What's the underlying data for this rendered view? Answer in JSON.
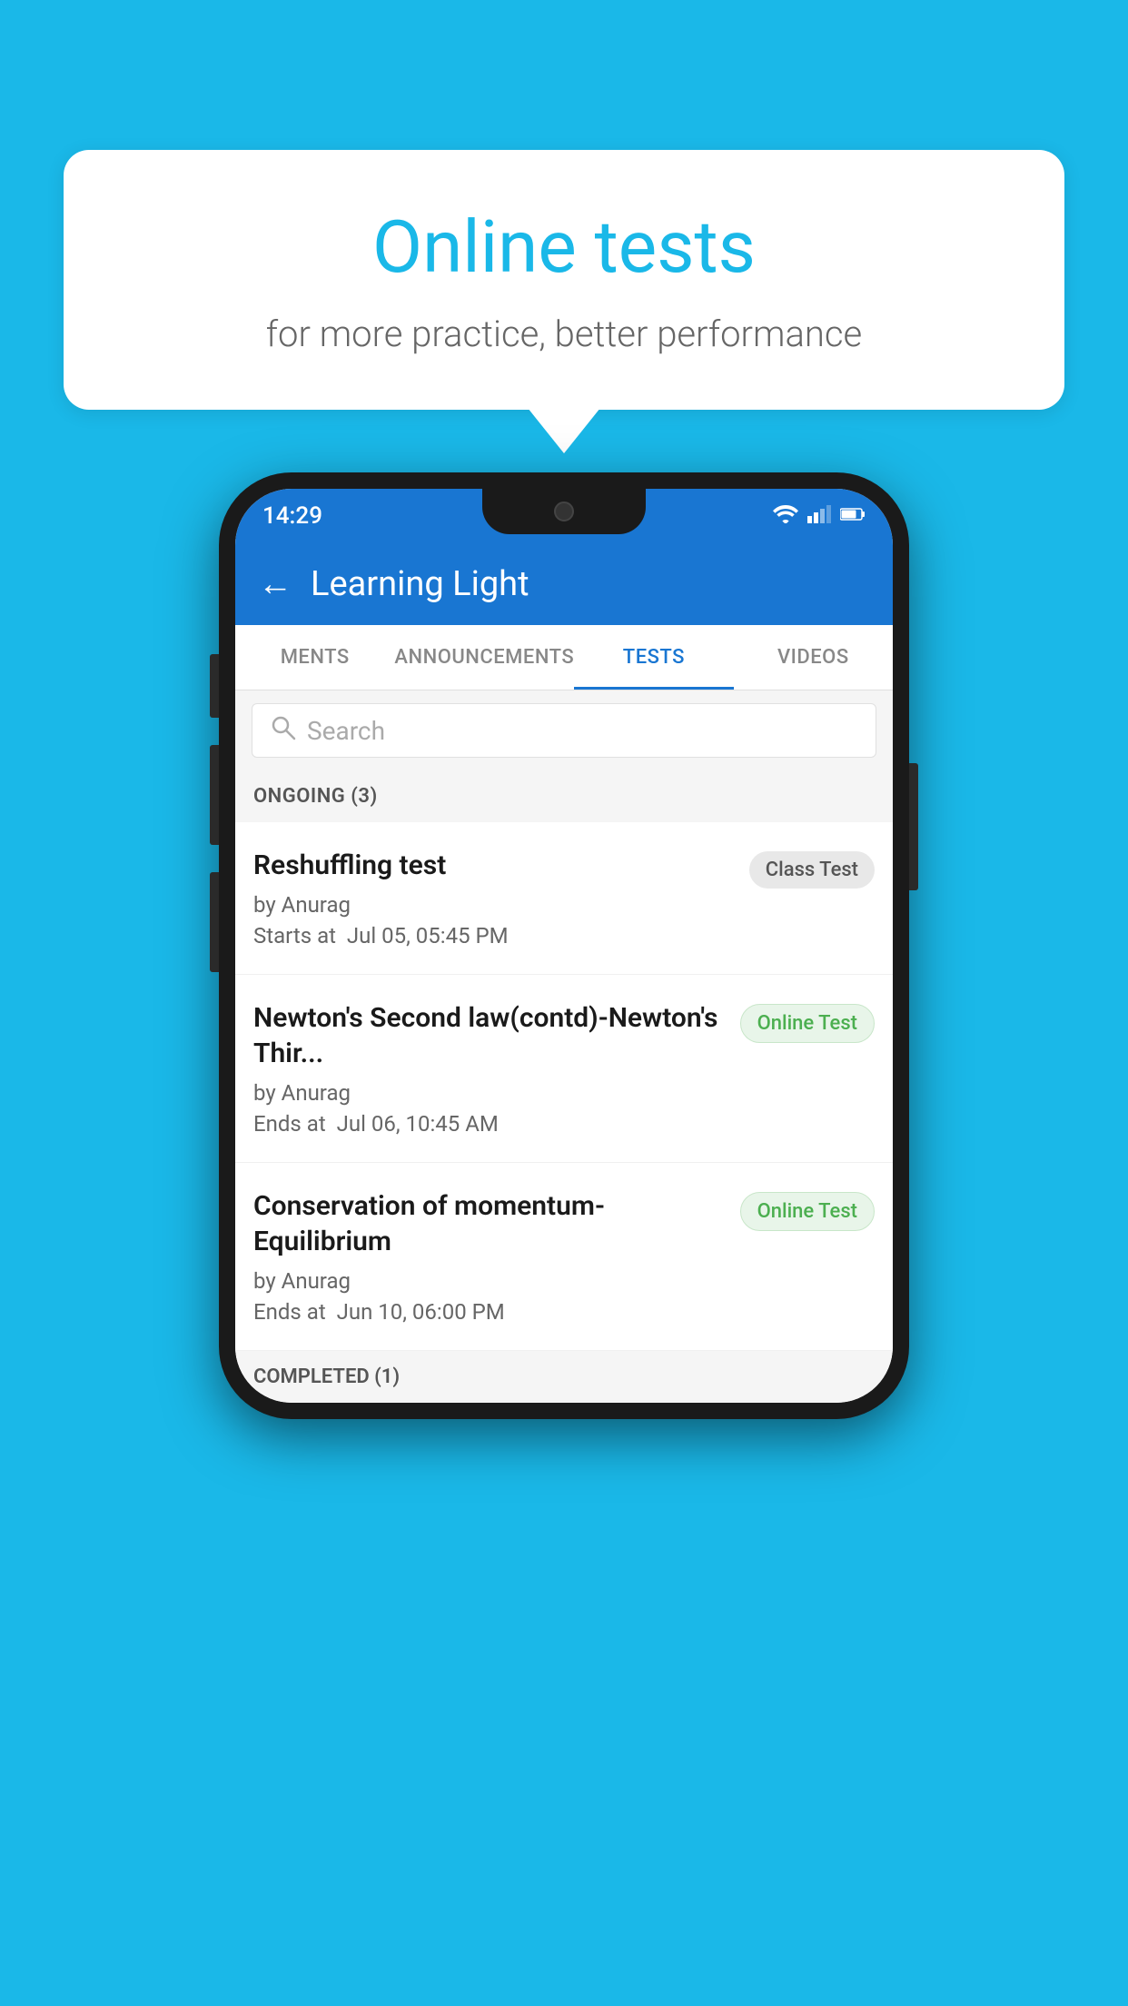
{
  "background_color": "#1ab8e8",
  "speech_bubble": {
    "title": "Online tests",
    "subtitle": "for more practice, better performance"
  },
  "status_bar": {
    "time": "14:29",
    "wifi": "▼",
    "signal": "▲",
    "battery": "▮"
  },
  "app_bar": {
    "back_label": "←",
    "title": "Learning Light"
  },
  "tabs": [
    {
      "label": "MENTS",
      "active": false
    },
    {
      "label": "ANNOUNCEMENTS",
      "active": false
    },
    {
      "label": "TESTS",
      "active": true
    },
    {
      "label": "VIDEOS",
      "active": false
    }
  ],
  "search": {
    "placeholder": "Search"
  },
  "ongoing_section": {
    "label": "ONGOING (3)"
  },
  "tests": [
    {
      "title": "Reshuffling test",
      "author": "by Anurag",
      "date_label": "Starts at",
      "date": "Jul 05, 05:45 PM",
      "badge": "Class Test",
      "badge_type": "class"
    },
    {
      "title": "Newton's Second law(contd)-Newton's Thir...",
      "author": "by Anurag",
      "date_label": "Ends at",
      "date": "Jul 06, 10:45 AM",
      "badge": "Online Test",
      "badge_type": "online"
    },
    {
      "title": "Conservation of momentum-Equilibrium",
      "author": "by Anurag",
      "date_label": "Ends at",
      "date": "Jun 10, 06:00 PM",
      "badge": "Online Test",
      "badge_type": "online"
    }
  ],
  "completed_section": {
    "label": "COMPLETED (1)"
  }
}
